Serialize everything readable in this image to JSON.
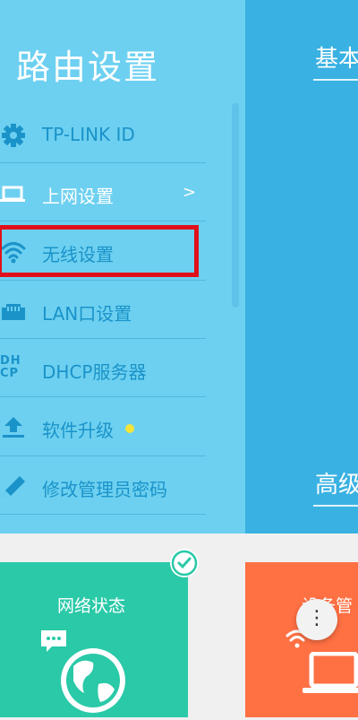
{
  "drawer": {
    "title": "路由设置",
    "items": [
      {
        "label": "TP-LINK ID",
        "icon": "gear-icon"
      },
      {
        "label": "上网设置",
        "icon": "laptop-icon",
        "arrow": ">"
      },
      {
        "label": "无线设置",
        "icon": "wifi-icon"
      },
      {
        "label": "LAN口设置",
        "icon": "ethernet-port-icon"
      },
      {
        "label": "DHCP服务器",
        "icon": "dhcp-icon",
        "icon_text_top": "DH",
        "icon_text_bottom": "CP"
      },
      {
        "label": "软件升级",
        "icon": "upload-icon",
        "badge": "yellow-dot"
      },
      {
        "label": "修改管理员密码",
        "icon": "pencil-icon"
      }
    ]
  },
  "main": {
    "section_basic": "基本",
    "section_advanced": "高级"
  },
  "cards": {
    "network_status": "网络状态",
    "device_management": "设备管"
  },
  "more_button": {
    "glyph": "⋮"
  },
  "colors": {
    "drawer_bg": "#6dd0f0",
    "main_bg": "#39b1e2",
    "menu_text": "#1a93c9",
    "highlight": "#e0101a",
    "network_card": "#2ac9a8",
    "device_card": "#ff7043"
  }
}
